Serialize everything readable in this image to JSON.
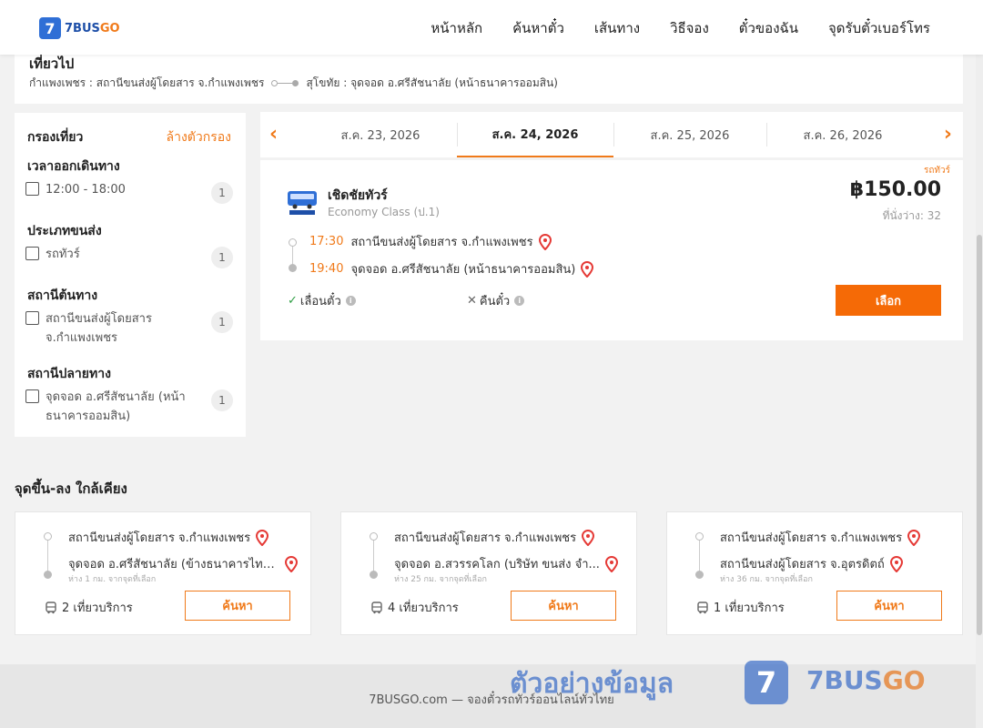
{
  "brand": {
    "logo_glyph": "7",
    "name_part1": "7BUS",
    "name_part2": "GO"
  },
  "nav": [
    "หน้าหลัก",
    "ค้นหาตั๋ว",
    "เส้นทาง",
    "วิธีจอง",
    "ตั๋วของฉัน",
    "จุดรับตั๋วเบอร์โทร"
  ],
  "route": {
    "title": "เที่ยวไป",
    "from": "กำแพงเพชร : สถานีขนส่งผู้โดยสาร จ.กำแพงเพชร",
    "to": "สุโขทัย : จุดจอด อ.ศรีสัชนาลัย (หน้าธนาคารออมสิน)"
  },
  "filters": {
    "title": "กรองเที่ยว",
    "clear": "ล้างตัวกรอง",
    "groups": [
      {
        "title": "เวลาออกเดินทาง",
        "option": "12:00 - 18:00",
        "count": "1"
      },
      {
        "title": "ประเภทขนส่ง",
        "option": "รถทัวร์",
        "count": "1"
      },
      {
        "title": "สถานีต้นทาง",
        "option": "สถานีขนส่งผู้โดยสาร จ.กำแพงเพชร",
        "count": "1"
      },
      {
        "title": "สถานีปลายทาง",
        "option": "จุดจอด อ.ศรีสัชนาลัย (หน้าธนาคารออมสิน)",
        "count": "1"
      }
    ]
  },
  "dates": {
    "prev_icon": "‹",
    "next_icon": "›",
    "tabs": [
      "ส.ค. 23, 2026",
      "ส.ค. 24, 2026",
      "ส.ค. 25, 2026",
      "ส.ค. 26, 2026"
    ],
    "active_index": 1
  },
  "trip": {
    "tag": "รถทัวร์",
    "operator": "เชิดชัยทัวร์",
    "class": "Economy Class (ป.1)",
    "price": "฿150.00",
    "seats": "ที่นั่งว่าง: 32",
    "depart_time": "17:30",
    "depart_station": "สถานีขนส่งผู้โดยสาร จ.กำแพงเพชร",
    "arrive_time": "19:40",
    "arrive_station": "จุดจอด อ.ศรีสัชนาลัย (หน้าธนาคารออมสิน)",
    "feature1": "เลื่อนตั๋ว",
    "feature2": "คืนตั๋ว",
    "select": "เลือก"
  },
  "nearby": {
    "title": "จุดขึ้น-ลง ใกล้เคียง",
    "cards": [
      {
        "from": "สถานีขนส่งผู้โดยสาร จ.กำแพงเพชร",
        "to": "จุดจอด อ.ศรีสัชนาลัย (ข้างธนาคารไทย...",
        "dist": "ห่าง 1 กม. จากจุดที่เลือก",
        "count": "2 เที่ยวบริการ",
        "btn": "ค้นหา"
      },
      {
        "from": "สถานีขนส่งผู้โดยสาร จ.กำแพงเพชร",
        "to": "จุดจอด อ.สวรรคโลก (บริษัท ขนส่ง จำ...",
        "dist": "ห่าง 25 กม. จากจุดที่เลือก",
        "count": "4 เที่ยวบริการ",
        "btn": "ค้นหา"
      },
      {
        "from": "สถานีขนส่งผู้โดยสาร จ.กำแพงเพชร",
        "to": "สถานีขนส่งผู้โดยสาร จ.อุตรดิตถ์",
        "dist": "ห่าง 36 กม. จากจุดที่เลือก",
        "count": "1 เที่ยวบริการ",
        "btn": "ค้นหา"
      }
    ]
  },
  "footer": "7BUSGO.com — จองตั๋วรถทัวร์ออนไลน์ทั่วไทย",
  "watermark": {
    "text": "ตัวอย่างข้อมูล",
    "logo_glyph": "7",
    "brand1": "7BUS",
    "brand2": "GO"
  },
  "colors": {
    "accent": "#f07a1a",
    "button": "#f56a06",
    "brand_blue": "#2f6fd6"
  }
}
